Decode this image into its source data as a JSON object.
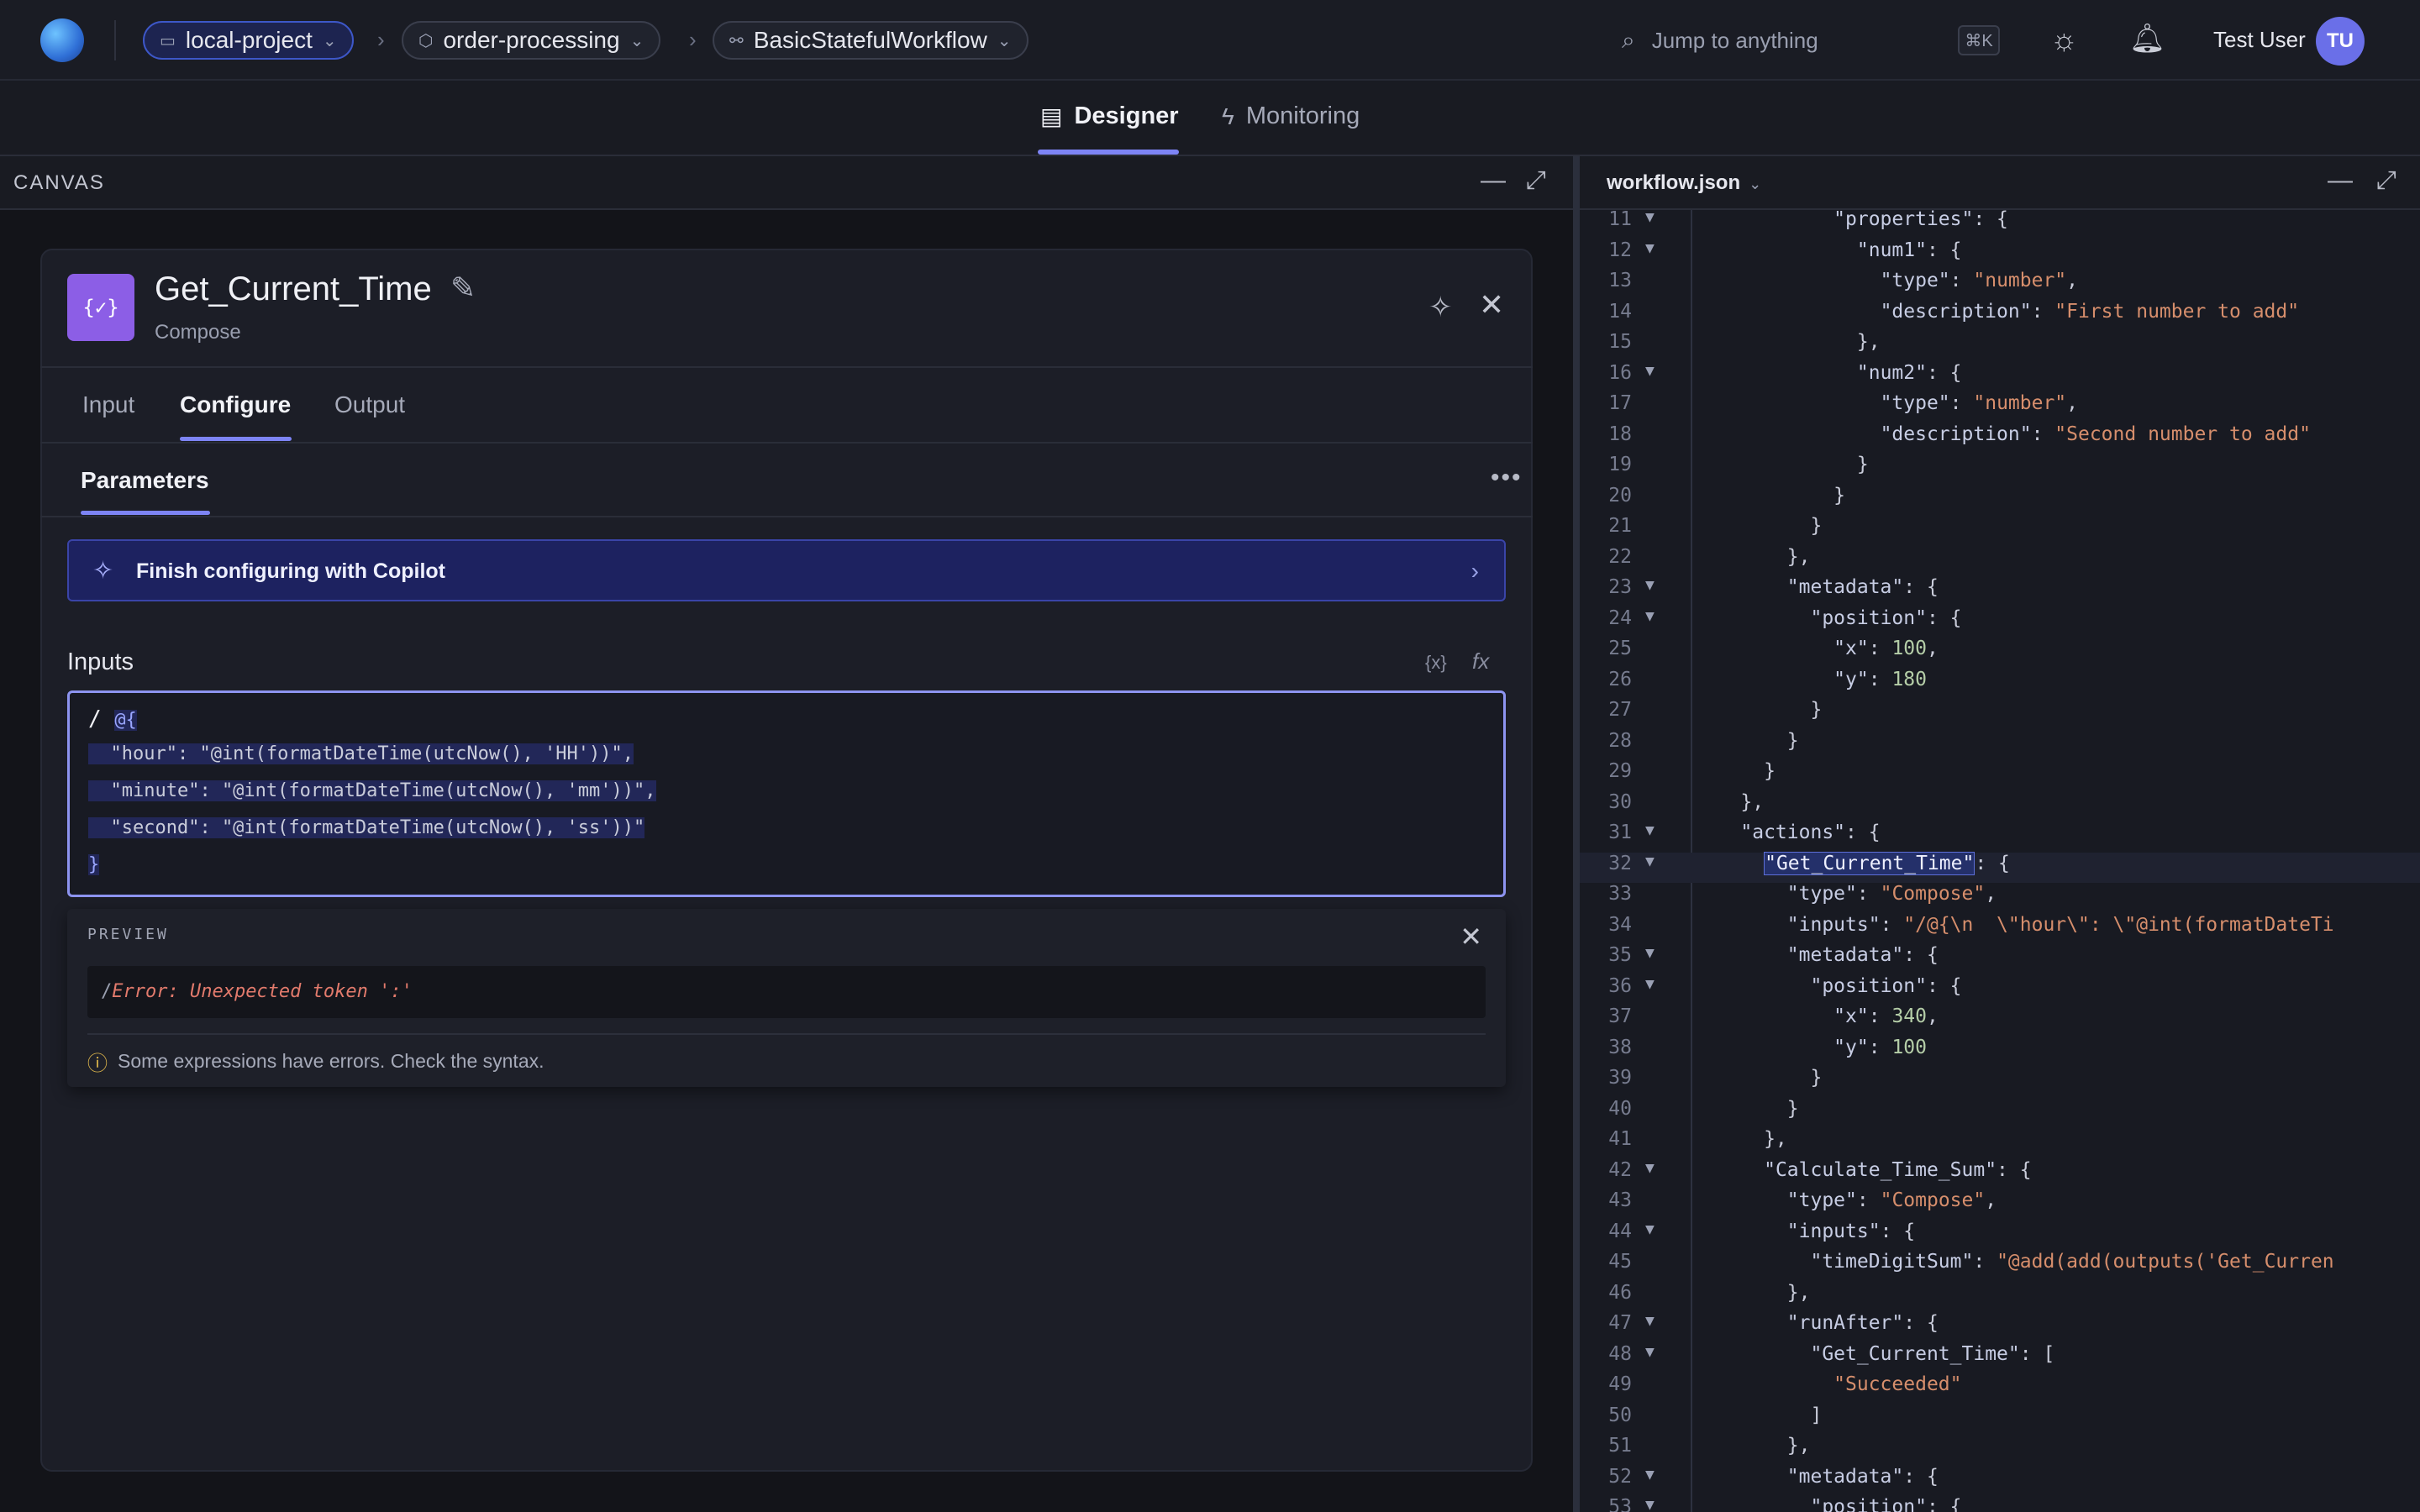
{
  "topbar": {
    "breadcrumbs": [
      {
        "label": "local-project",
        "icon": "folder-icon"
      },
      {
        "label": "order-processing",
        "icon": "cube-icon"
      },
      {
        "label": "BasicStatefulWorkflow",
        "icon": "workflow-icon"
      }
    ],
    "search_placeholder": "Jump to anything",
    "shortcut": "⌘K",
    "user_name": "Test User",
    "user_initials": "TU"
  },
  "mode_tabs": [
    {
      "label": "Designer",
      "selected": true
    },
    {
      "label": "Monitoring",
      "selected": false
    }
  ],
  "canvas": {
    "title": "CANVAS"
  },
  "node": {
    "title": "Get_Current_Time",
    "subtitle": "Compose",
    "icon_text": "{✓}",
    "tabs": [
      "Input",
      "Configure",
      "Output"
    ],
    "selected_tab": "Configure",
    "section_title": "Parameters",
    "copilot_label": "Finish configuring with Copilot",
    "inputs_label": "Inputs",
    "editor_lines": [
      "@{",
      "  \"hour\": \"@int(formatDateTime(utcNow(), 'HH'))\",",
      "  \"minute\": \"@int(formatDateTime(utcNow(), 'mm'))\",",
      "  \"second\": \"@int(formatDateTime(utcNow(), 'ss'))\"",
      "}"
    ],
    "preview": {
      "title": "PREVIEW",
      "code_prefix": "/",
      "code_error": "Error: Unexpected token ':'",
      "warning": "Some expressions have errors. Check the syntax."
    }
  },
  "code_panel": {
    "filename": "workflow.json",
    "lines": [
      {
        "n": "11",
        "fold": true,
        "text": "            \"properties\": {"
      },
      {
        "n": "12",
        "fold": true,
        "text": "              \"num1\": {"
      },
      {
        "n": "13",
        "fold": false,
        "text": "                \"type\": \"number\","
      },
      {
        "n": "14",
        "fold": false,
        "text": "                \"description\": \"First number to add\""
      },
      {
        "n": "15",
        "fold": false,
        "text": "              },"
      },
      {
        "n": "16",
        "fold": true,
        "text": "              \"num2\": {"
      },
      {
        "n": "17",
        "fold": false,
        "text": "                \"type\": \"number\","
      },
      {
        "n": "18",
        "fold": false,
        "text": "                \"description\": \"Second number to add\""
      },
      {
        "n": "19",
        "fold": false,
        "text": "              }"
      },
      {
        "n": "20",
        "fold": false,
        "text": "            }"
      },
      {
        "n": "21",
        "fold": false,
        "text": "          }"
      },
      {
        "n": "22",
        "fold": false,
        "text": "        },"
      },
      {
        "n": "23",
        "fold": true,
        "text": "        \"metadata\": {"
      },
      {
        "n": "24",
        "fold": true,
        "text": "          \"position\": {"
      },
      {
        "n": "25",
        "fold": false,
        "text": "            \"x\": 100,"
      },
      {
        "n": "26",
        "fold": false,
        "text": "            \"y\": 180"
      },
      {
        "n": "27",
        "fold": false,
        "text": "          }"
      },
      {
        "n": "28",
        "fold": false,
        "text": "        }"
      },
      {
        "n": "29",
        "fold": false,
        "text": "      }"
      },
      {
        "n": "30",
        "fold": false,
        "text": "    },"
      },
      {
        "n": "31",
        "fold": true,
        "text": "    \"actions\": {"
      },
      {
        "n": "32",
        "fold": true,
        "text": "      \"Get_Current_Time\": {",
        "current": true
      },
      {
        "n": "33",
        "fold": false,
        "text": "        \"type\": \"Compose\","
      },
      {
        "n": "34",
        "fold": false,
        "text": "        \"inputs\": \"/@{\\n  \\\"hour\\\": \\\"@int(formatDateTi"
      },
      {
        "n": "35",
        "fold": true,
        "text": "        \"metadata\": {"
      },
      {
        "n": "36",
        "fold": true,
        "text": "          \"position\": {"
      },
      {
        "n": "37",
        "fold": false,
        "text": "            \"x\": 340,"
      },
      {
        "n": "38",
        "fold": false,
        "text": "            \"y\": 100"
      },
      {
        "n": "39",
        "fold": false,
        "text": "          }"
      },
      {
        "n": "40",
        "fold": false,
        "text": "        }"
      },
      {
        "n": "41",
        "fold": false,
        "text": "      },"
      },
      {
        "n": "42",
        "fold": true,
        "text": "      \"Calculate_Time_Sum\": {"
      },
      {
        "n": "43",
        "fold": false,
        "text": "        \"type\": \"Compose\","
      },
      {
        "n": "44",
        "fold": true,
        "text": "        \"inputs\": {"
      },
      {
        "n": "45",
        "fold": false,
        "text": "          \"timeDigitSum\": \"@add(add(outputs('Get_Curren"
      },
      {
        "n": "46",
        "fold": false,
        "text": "        },"
      },
      {
        "n": "47",
        "fold": true,
        "text": "        \"runAfter\": {"
      },
      {
        "n": "48",
        "fold": true,
        "text": "          \"Get_Current_Time\": ["
      },
      {
        "n": "49",
        "fold": false,
        "text": "            \"Succeeded\""
      },
      {
        "n": "50",
        "fold": false,
        "text": "          ]"
      },
      {
        "n": "51",
        "fold": false,
        "text": "        },"
      },
      {
        "n": "52",
        "fold": true,
        "text": "        \"metadata\": {"
      },
      {
        "n": "53",
        "fold": true,
        "text": "          \"position\": {"
      }
    ]
  },
  "colors": {
    "accent": "#7d84f5",
    "copilot_bg": "#1d2260",
    "error": "#e27a6c",
    "node_icon": "#8c5ee6"
  }
}
